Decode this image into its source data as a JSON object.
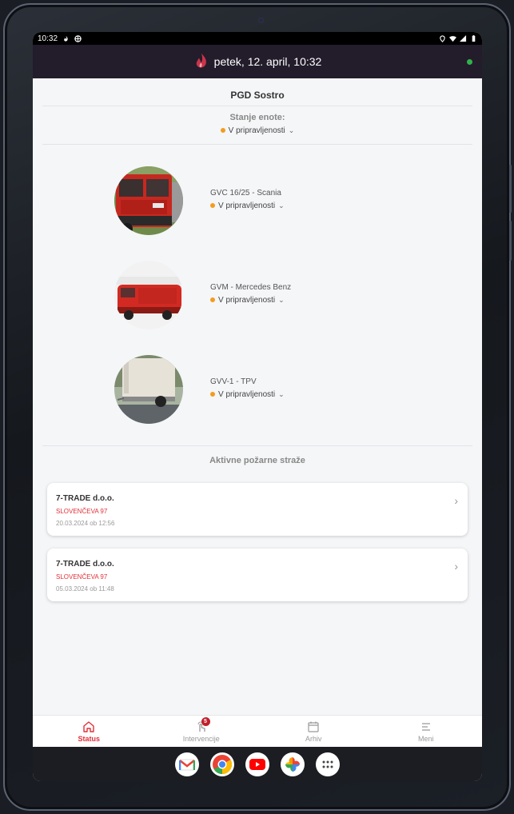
{
  "statusbar": {
    "time": "10:32"
  },
  "appbar": {
    "title": "petek, 12. april, 10:32"
  },
  "unit": {
    "name": "PGD Sostro",
    "state_label": "Stanje enote:",
    "state": "V pripravljenosti"
  },
  "vehicles": [
    {
      "name": "GVC 16/25 - Scania",
      "status": "V pripravljenosti"
    },
    {
      "name": "GVM - Mercedes Benz",
      "status": "V pripravljenosti"
    },
    {
      "name": "GVV-1 - TPV",
      "status": "V pripravljenosti"
    }
  ],
  "guards": {
    "title": "Aktivne požarne straže",
    "items": [
      {
        "company": "7-TRADE d.o.o.",
        "address": "SLOVENČEVA  97",
        "date": "20.03.2024 ob 12:56"
      },
      {
        "company": "7-TRADE d.o.o.",
        "address": "SLOVENČEVA  97",
        "date": "05.03.2024 ob 11:48"
      }
    ]
  },
  "nav": {
    "status": "Status",
    "interventions": "Intervencije",
    "interventions_badge": "5",
    "archive": "Arhiv",
    "menu": "Meni"
  },
  "colors": {
    "accent": "#e0303a",
    "standby": "#f39c1f",
    "online": "#2fb34a",
    "appbar": "#231c2b"
  },
  "dock_apps": [
    "gmail-icon",
    "chrome-icon",
    "youtube-icon",
    "photos-icon",
    "app-drawer-icon"
  ]
}
